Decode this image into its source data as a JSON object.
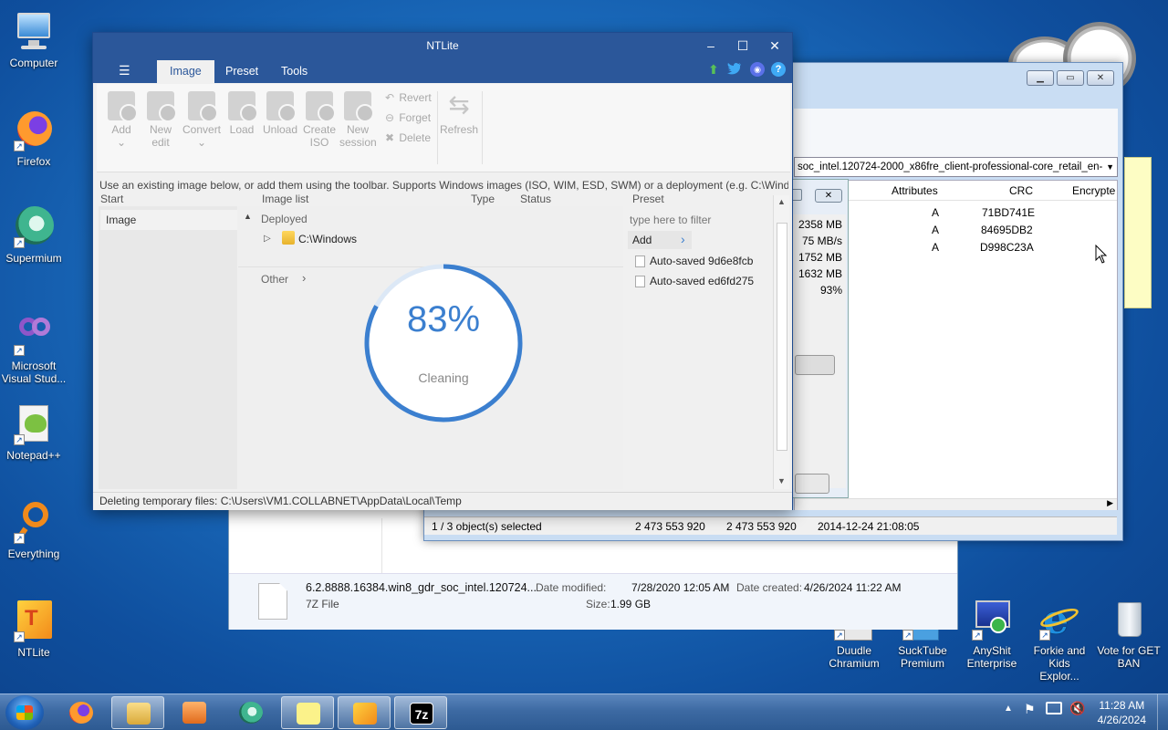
{
  "desktop_icons": [
    {
      "label": "Computer"
    },
    {
      "label": "Firefox"
    },
    {
      "label": "Supermium"
    },
    {
      "label": "Microsoft Visual Stud..."
    },
    {
      "label": "Notepad++"
    },
    {
      "label": "Everything"
    },
    {
      "label": "NTLite"
    },
    {
      "label": "Duudle Chramium"
    },
    {
      "label": "SuckTube Premium"
    },
    {
      "label": "AnyShit Enterprise"
    },
    {
      "label": "Forkie and Kids Explor..."
    },
    {
      "label": "Vote for GET BAN"
    }
  ],
  "explorer": {
    "file_name": "6.2.8888.16384.win8_gdr_soc_intel.120724...",
    "file_type": "7Z File",
    "date_modified_label": "Date modified:",
    "date_modified": "7/28/2020 12:05 AM",
    "date_created_label": "Date created:",
    "date_created": "4/26/2024 11:22 AM",
    "size_label": "Size:",
    "size": "1.99 GB"
  },
  "zip": {
    "path": "soc_intel.120724-2000_x86fre_client-professional-core_retail_en-",
    "columns": [
      "Attributes",
      "CRC",
      "Encrypte"
    ],
    "rows": [
      {
        "attr": "A",
        "crc": "71BD741E"
      },
      {
        "attr": "A",
        "crc": "84695DB2"
      },
      {
        "attr": "A",
        "crc": "D998C23A"
      }
    ],
    "progress_values": [
      "2358 MB",
      "75 MB/s",
      "1752 MB",
      "1632 MB",
      "93%"
    ],
    "status": {
      "selected": "1 / 3 object(s) selected",
      "size": "2 473 553 920",
      "packed": "2 473 553 920",
      "modified": "2014-12-24 21:08:05"
    }
  },
  "ntlite": {
    "title": "NTLite",
    "menu_icon": "☰",
    "tabs": [
      "Image",
      "Preset",
      "Tools"
    ],
    "ribbon": [
      {
        "label": "Add",
        "sub": "⌄"
      },
      {
        "label": "New",
        "sub": "edit"
      },
      {
        "label": "Convert",
        "sub": "⌄"
      },
      {
        "label": "Load",
        "sub": ""
      },
      {
        "label": "Unload",
        "sub": ""
      },
      {
        "label": "Create",
        "sub": "ISO"
      },
      {
        "label": "New",
        "sub": "session"
      }
    ],
    "ribbon_small": [
      "Revert",
      "Forget",
      "Delete"
    ],
    "refresh_label": "Refresh",
    "hint": "Use an existing image below, or add them using the toolbar. Supports Windows images (ISO, WIM, ESD, SWM) or a deployment (e.g. C:\\Wind...",
    "columns": {
      "start": "Start",
      "image_list": "Image list",
      "type": "Type",
      "status": "Status",
      "preset": "Preset"
    },
    "left_item": "Image",
    "deployed_label": "Deployed",
    "windows_item": "C:\\Windows",
    "other_label": "Other",
    "filter_placeholder": "type here to filter",
    "add_label": "Add",
    "presets": [
      "Auto-saved 9d6e8fcb",
      "Auto-saved ed6fd275"
    ],
    "progress": {
      "percent_text": "83%",
      "percent": 83,
      "label": "Cleaning"
    },
    "status_text": "Deleting temporary files: C:\\Users\\VM1.COLLABNET\\AppData\\Local\\Temp"
  },
  "taskbar": {
    "time": "11:28 AM",
    "date": "4/26/2024",
    "zip_label": "7z"
  },
  "colors": {
    "ntlite_blue": "#2b579a",
    "progress_ring": "#3b7fcf"
  }
}
